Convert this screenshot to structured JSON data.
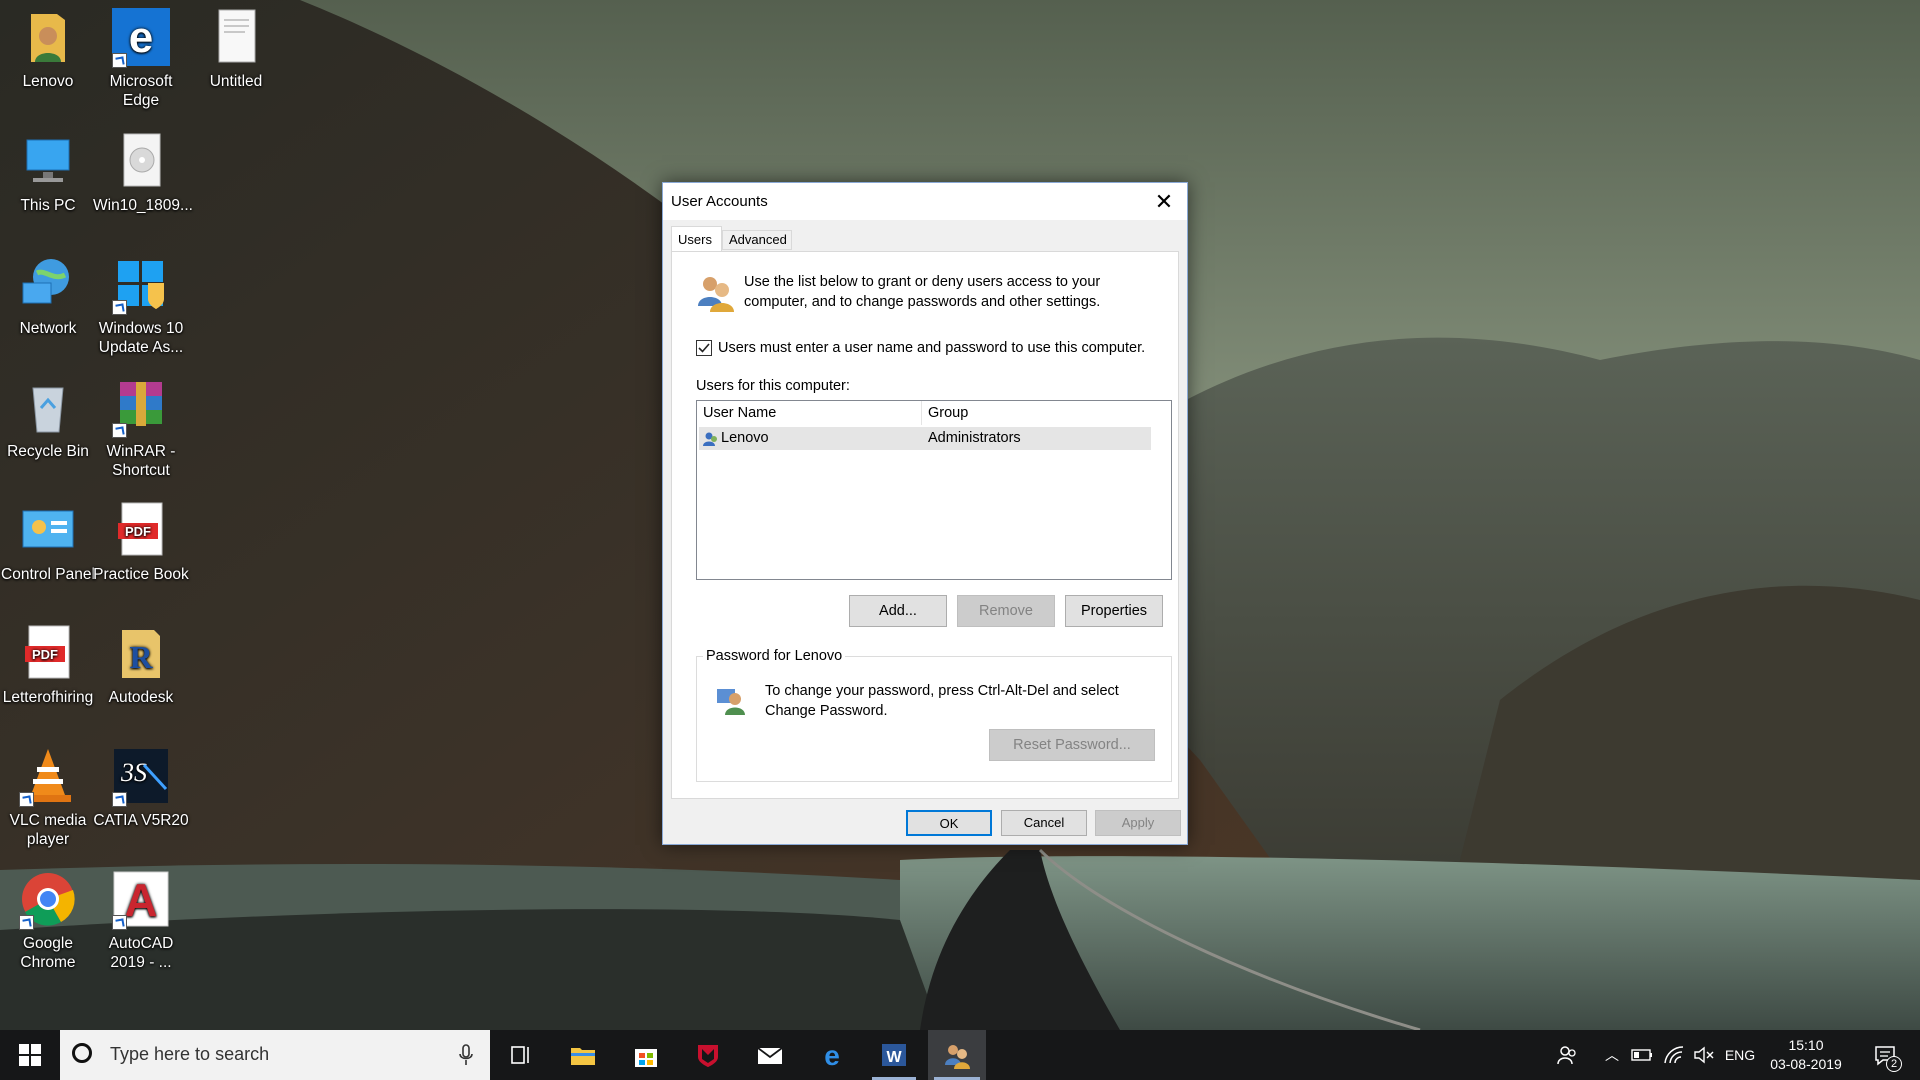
{
  "desktop": {
    "icons": [
      {
        "label": "Lenovo"
      },
      {
        "label": "Microsoft\nEdge"
      },
      {
        "label": "Untitled"
      },
      {
        "label": "This PC"
      },
      {
        "label": "Win10_1809..."
      },
      {
        "label": "Network"
      },
      {
        "label": "Windows 10\nUpdate As..."
      },
      {
        "label": "Recycle Bin"
      },
      {
        "label": "WinRAR -\nShortcut"
      },
      {
        "label": "Control Panel"
      },
      {
        "label": "Practice Book"
      },
      {
        "label": "Letterofhiring"
      },
      {
        "label": "Autodesk"
      },
      {
        "label": "VLC media\nplayer"
      },
      {
        "label": "CATIA V5R20"
      },
      {
        "label": "Google\nChrome"
      },
      {
        "label": "AutoCAD\n2019 - ..."
      }
    ]
  },
  "dialog": {
    "title": "User Accounts",
    "tabs": [
      {
        "label": "Users"
      },
      {
        "label": "Advanced"
      }
    ],
    "intro": "Use the list below to grant or deny users access to your computer, and to change passwords and other settings.",
    "require_password_label": "Users must enter a user name and password to use this computer.",
    "require_password_checked": true,
    "users_label": "Users for this computer:",
    "columns": [
      "User Name",
      "Group"
    ],
    "rows": [
      {
        "user": "Lenovo",
        "group": "Administrators"
      }
    ],
    "buttons": {
      "add": "Add...",
      "remove": "Remove",
      "properties": "Properties"
    },
    "password_group": {
      "legend": "Password for Lenovo",
      "text": "To change your password, press Ctrl-Alt-Del and select Change Password.",
      "reset": "Reset Password..."
    },
    "footer": {
      "ok": "OK",
      "cancel": "Cancel",
      "apply": "Apply"
    }
  },
  "taskbar": {
    "search_placeholder": "Type here to search",
    "language": "ENG",
    "time": "15:10",
    "date": "03-08-2019",
    "notification_count": "2"
  }
}
